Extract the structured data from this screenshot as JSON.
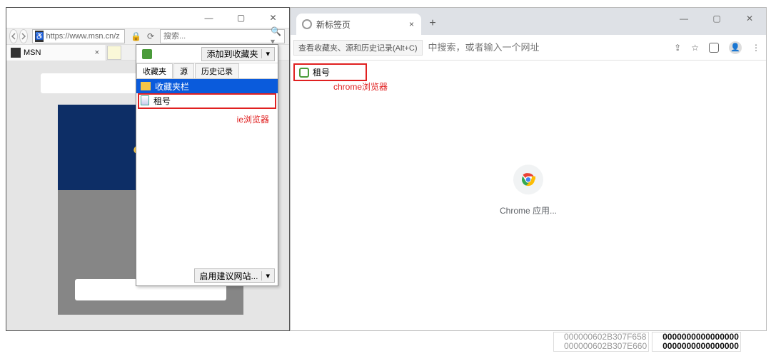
{
  "ie": {
    "window_controls": {
      "min": "—",
      "max": "▢",
      "close": "✕"
    },
    "address_bar": {
      "url": "https://www.msn.cn/z",
      "lock": "🔒",
      "search_placeholder": "搜索..."
    },
    "tab": {
      "title": "MSN",
      "close": "×"
    },
    "favorites_panel": {
      "add_favorite_label": "添加到收藏夹",
      "tabs": {
        "fav": "收藏夹",
        "feed": "源",
        "history": "历史记录"
      },
      "items": [
        {
          "label": "收藏夹栏",
          "selected": true,
          "type": "folder"
        },
        {
          "label": "租号",
          "selected": false,
          "type": "page"
        }
      ],
      "suggest_label": "启用建议网站...",
      "annotation": "ie浏览器"
    }
  },
  "chrome": {
    "window_controls": {
      "min": "—",
      "max": "▢",
      "close": "✕"
    },
    "tab": {
      "title": "新标签页",
      "close": "×"
    },
    "omnibox_tip": "查看收藏夹、源和历史记录(Alt+C)",
    "omnibox_tail": "中搜索，或者输入一个网址",
    "bookmark_item": "租号",
    "annotation": "chrome浏览器",
    "apps_label": "Chrome 应用..."
  },
  "hex": {
    "col1": [
      "000000602B307F658",
      "000000602B307E660"
    ],
    "col2": [
      "0000000000000000",
      "0000000000000000"
    ]
  }
}
